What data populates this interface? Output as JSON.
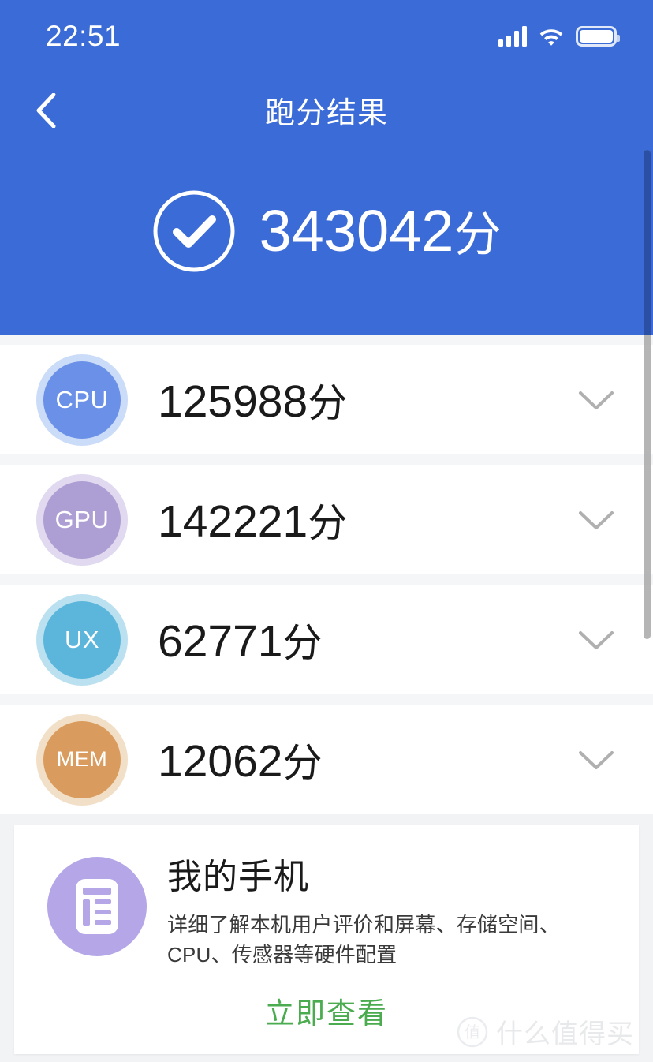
{
  "statusbar": {
    "time": "22:51",
    "signal_icon": "signal-bars-icon",
    "wifi_icon": "wifi-icon",
    "battery_icon": "battery-full-icon"
  },
  "header": {
    "title": "跑分结果",
    "back_icon": "chevron-left-icon",
    "background_color": "#3a6bd6"
  },
  "total": {
    "check_icon": "check-circle-icon",
    "score": "343042",
    "unit": "分"
  },
  "scores": [
    {
      "label": "CPU",
      "score": "125988",
      "unit": "分",
      "core_color": "#6b90e8",
      "halo_color": "#cbdcf8",
      "chevron_icon": "chevron-down-icon"
    },
    {
      "label": "GPU",
      "score": "142221",
      "unit": "分",
      "core_color": "#ad9ed4",
      "halo_color": "#e0d9ef",
      "chevron_icon": "chevron-down-icon"
    },
    {
      "label": "UX",
      "score": "62771",
      "unit": "分",
      "core_color": "#5cb6db",
      "halo_color": "#bbe1f0",
      "chevron_icon": "chevron-down-icon"
    },
    {
      "label": "MEM",
      "score": "12062",
      "unit": "分",
      "core_color": "#d99c5e",
      "halo_color": "#f2dfc7",
      "chevron_icon": "chevron-down-icon"
    }
  ],
  "phone_card": {
    "icon": "document-list-icon",
    "icon_color": "#b5a6e8",
    "title": "我的手机",
    "description": "详细了解本机用户评价和屏幕、存储空间、CPU、传感器等硬件配置",
    "cta_label": "立即查看",
    "cta_color": "#4aab4f"
  },
  "watermark": {
    "logo_text": "值",
    "text": "什么值得买"
  }
}
